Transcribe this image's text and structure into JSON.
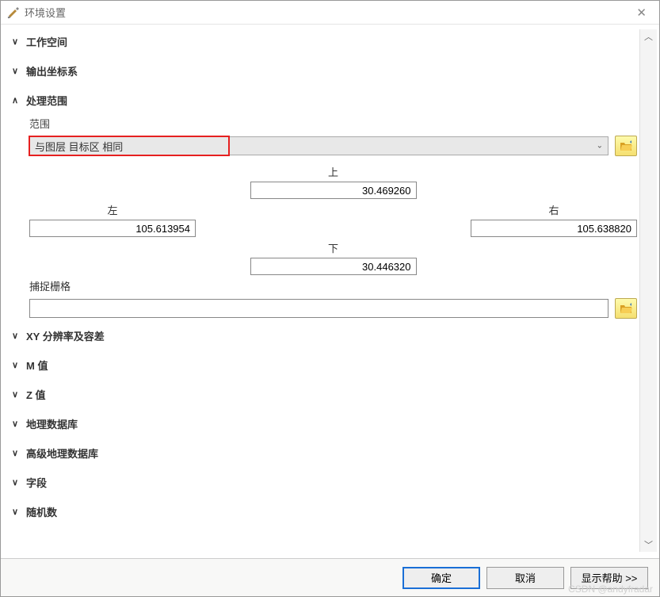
{
  "window": {
    "title": "环境设置"
  },
  "sections": {
    "workspace": "工作空间",
    "output_cs": "输出坐标系",
    "extent": "处理范围",
    "xy_res": "XY 分辨率及容差",
    "m_val": "M 值",
    "z_val": "Z 值",
    "geodb": "地理数据库",
    "adv_geodb": "高级地理数据库",
    "fields": "字段",
    "random": "随机数"
  },
  "extent": {
    "label": "范围",
    "dropdown_value": "与图层 目标区 相同",
    "top_label": "上",
    "top_value": "30.469260",
    "left_label": "左",
    "left_value": "105.613954",
    "right_label": "右",
    "right_value": "105.638820",
    "bottom_label": "下",
    "bottom_value": "30.446320",
    "snap_label": "捕捉栅格",
    "snap_value": ""
  },
  "buttons": {
    "ok": "确定",
    "cancel": "取消",
    "help": "显示帮助 >>"
  },
  "watermark": "CSDN @andyfradar"
}
